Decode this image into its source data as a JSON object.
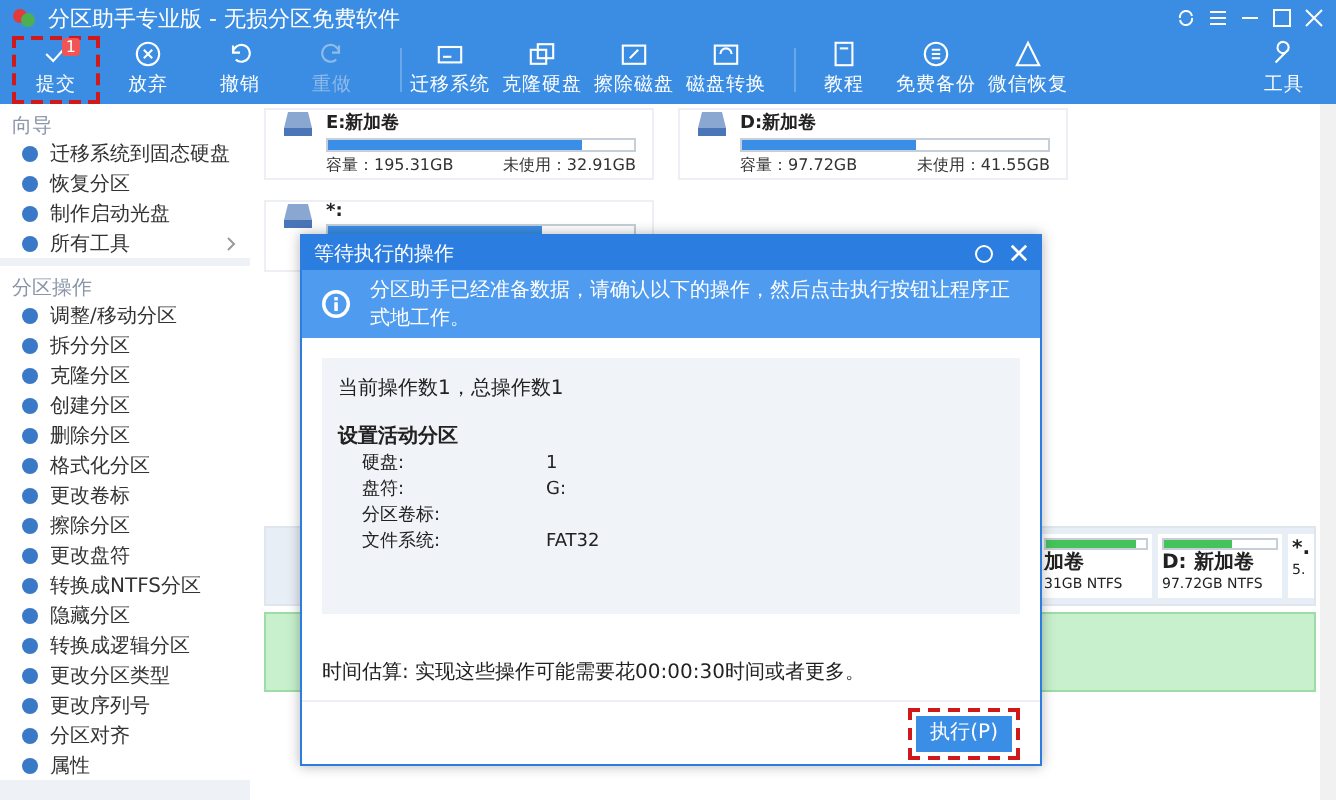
{
  "window": {
    "title": "分区助手专业版 - 无损分区免费软件"
  },
  "toolbar": [
    {
      "label": "提交",
      "disabled": false,
      "highlighted": true,
      "badge": "1"
    },
    {
      "label": "放弃",
      "disabled": false,
      "highlighted": false
    },
    {
      "label": "撤销",
      "disabled": false,
      "highlighted": false
    },
    {
      "label": "重做",
      "disabled": true,
      "highlighted": false
    },
    {
      "label": "迁移系统",
      "disabled": false,
      "highlighted": false
    },
    {
      "label": "克隆硬盘",
      "disabled": false,
      "highlighted": false
    },
    {
      "label": "擦除磁盘",
      "disabled": false,
      "highlighted": false
    },
    {
      "label": "磁盘转换",
      "disabled": false,
      "highlighted": false
    },
    {
      "label": "教程",
      "disabled": false,
      "highlighted": false
    },
    {
      "label": "免费备份",
      "disabled": false,
      "highlighted": false
    },
    {
      "label": "微信恢复",
      "disabled": false,
      "highlighted": false
    }
  ],
  "tools_button": {
    "label": "工具"
  },
  "sidebar": [
    {
      "title": "向导",
      "items": [
        {
          "label": "迁移系统到固态硬盘"
        },
        {
          "label": "恢复分区"
        },
        {
          "label": "制作启动光盘"
        },
        {
          "label": "所有工具",
          "submenu": true
        }
      ]
    },
    {
      "title": "分区操作",
      "items": [
        {
          "label": "调整/移动分区"
        },
        {
          "label": "拆分分区"
        },
        {
          "label": "克隆分区"
        },
        {
          "label": "创建分区"
        },
        {
          "label": "删除分区"
        },
        {
          "label": "格式化分区"
        },
        {
          "label": "更改卷标"
        },
        {
          "label": "擦除分区"
        },
        {
          "label": "更改盘符"
        },
        {
          "label": "转换成NTFS分区"
        },
        {
          "label": "隐藏分区"
        },
        {
          "label": "转换成逻辑分区"
        },
        {
          "label": "更改分区类型"
        },
        {
          "label": "更改序列号"
        },
        {
          "label": "分区对齐"
        },
        {
          "label": "属性"
        }
      ]
    }
  ],
  "volumes": [
    {
      "name": "E:新加卷",
      "level": 0.83,
      "capacity": "容量：195.31GB",
      "free": "未使用：32.91GB"
    },
    {
      "name": "D:新加卷",
      "level": 0.57,
      "capacity": "容量：97.72GB",
      "free": "未使用：41.55GB"
    },
    {
      "name": "*:",
      "level": 0.7
    }
  ],
  "disk_rows": [
    {
      "partitions": [
        {
          "name": "加卷",
          "size": "31GB NTFS",
          "level": 0.9
        },
        {
          "name": "D: 新加卷",
          "size": "97.72GB NTFS",
          "level": 0.6
        },
        {
          "name": "*.",
          "size": "5."
        }
      ]
    },
    {
      "selected": true
    }
  ],
  "dialog": {
    "title": "等待执行的操作",
    "info": "分区助手已经准备数据，请确认以下的操作，然后点击执行按钮让程序正式地工作。",
    "count": "当前操作数1，总操作数1",
    "operation": "设置活动分区",
    "details": [
      {
        "key": "硬盘:",
        "value": "1"
      },
      {
        "key": "盘符:",
        "value": "G:"
      },
      {
        "key": "分区卷标:"
      },
      {
        "key": "文件系统:",
        "value": "FAT32"
      }
    ],
    "estimate": "时间估算: 实现这些操作可能需要花00:00:30时间或者更多。",
    "button": {
      "label": "执行(P)",
      "highlighted": true
    }
  }
}
